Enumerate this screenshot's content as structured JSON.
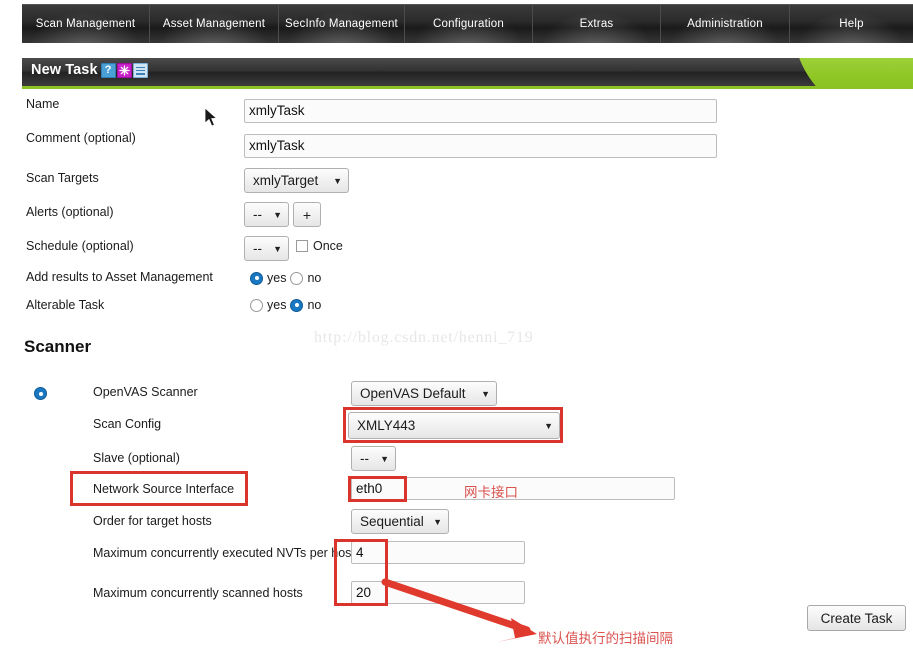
{
  "nav": {
    "items": [
      {
        "label": "Scan Management"
      },
      {
        "label": "Asset Management"
      },
      {
        "label": "SecInfo Management"
      },
      {
        "label": "Configuration"
      },
      {
        "label": "Extras"
      },
      {
        "label": "Administration"
      },
      {
        "label": "Help"
      }
    ]
  },
  "panel": {
    "title": "New Task",
    "icons": [
      "help-icon",
      "wizard-icon",
      "list-icon"
    ],
    "help_glyph": "?"
  },
  "form": {
    "name": {
      "label": "Name",
      "value": "xmlyTask"
    },
    "comment": {
      "label": "Comment (optional)",
      "value": "xmlyTask"
    },
    "scan_targets": {
      "label": "Scan Targets",
      "value": "xmlyTarget"
    },
    "alerts": {
      "label": "Alerts (optional)",
      "value": "--",
      "add_label": "+"
    },
    "schedule": {
      "label": "Schedule (optional)",
      "value": "--",
      "once_label": "Once"
    },
    "add_results": {
      "label": "Add results to Asset Management",
      "yes_label": "yes",
      "no_label": "no",
      "selected": "yes"
    },
    "alterable": {
      "label": "Alterable Task",
      "yes_label": "yes",
      "no_label": "no",
      "selected": "no"
    }
  },
  "scanner": {
    "section_title": "Scanner",
    "openvas_scanner": {
      "label": "OpenVAS Scanner",
      "value": "OpenVAS Default",
      "selected": true
    },
    "scan_config": {
      "label": "Scan Config",
      "value": "XMLY443"
    },
    "slave": {
      "label": "Slave (optional)",
      "value": "--"
    },
    "network_source_interface": {
      "label": "Network Source Interface",
      "value": "eth0"
    },
    "order_target_hosts": {
      "label": "Order for target hosts",
      "value": "Sequential"
    },
    "max_nvts": {
      "label": "Maximum concurrently executed NVTs per host",
      "value": "4"
    },
    "max_hosts": {
      "label": "Maximum concurrently scanned hosts",
      "value": "20"
    }
  },
  "annotations": {
    "nic_note": "网卡接口",
    "interval_note": "默认值执行的扫描间隔",
    "watermark": "http://blog.csdn.net/henni_719"
  },
  "actions": {
    "create_task": "Create Task"
  },
  "colors": {
    "accent_green": "#8cc323",
    "annotation_red": "#d9352c",
    "radio_blue": "#1a78c2",
    "header_dark": "#2b2b2b"
  }
}
